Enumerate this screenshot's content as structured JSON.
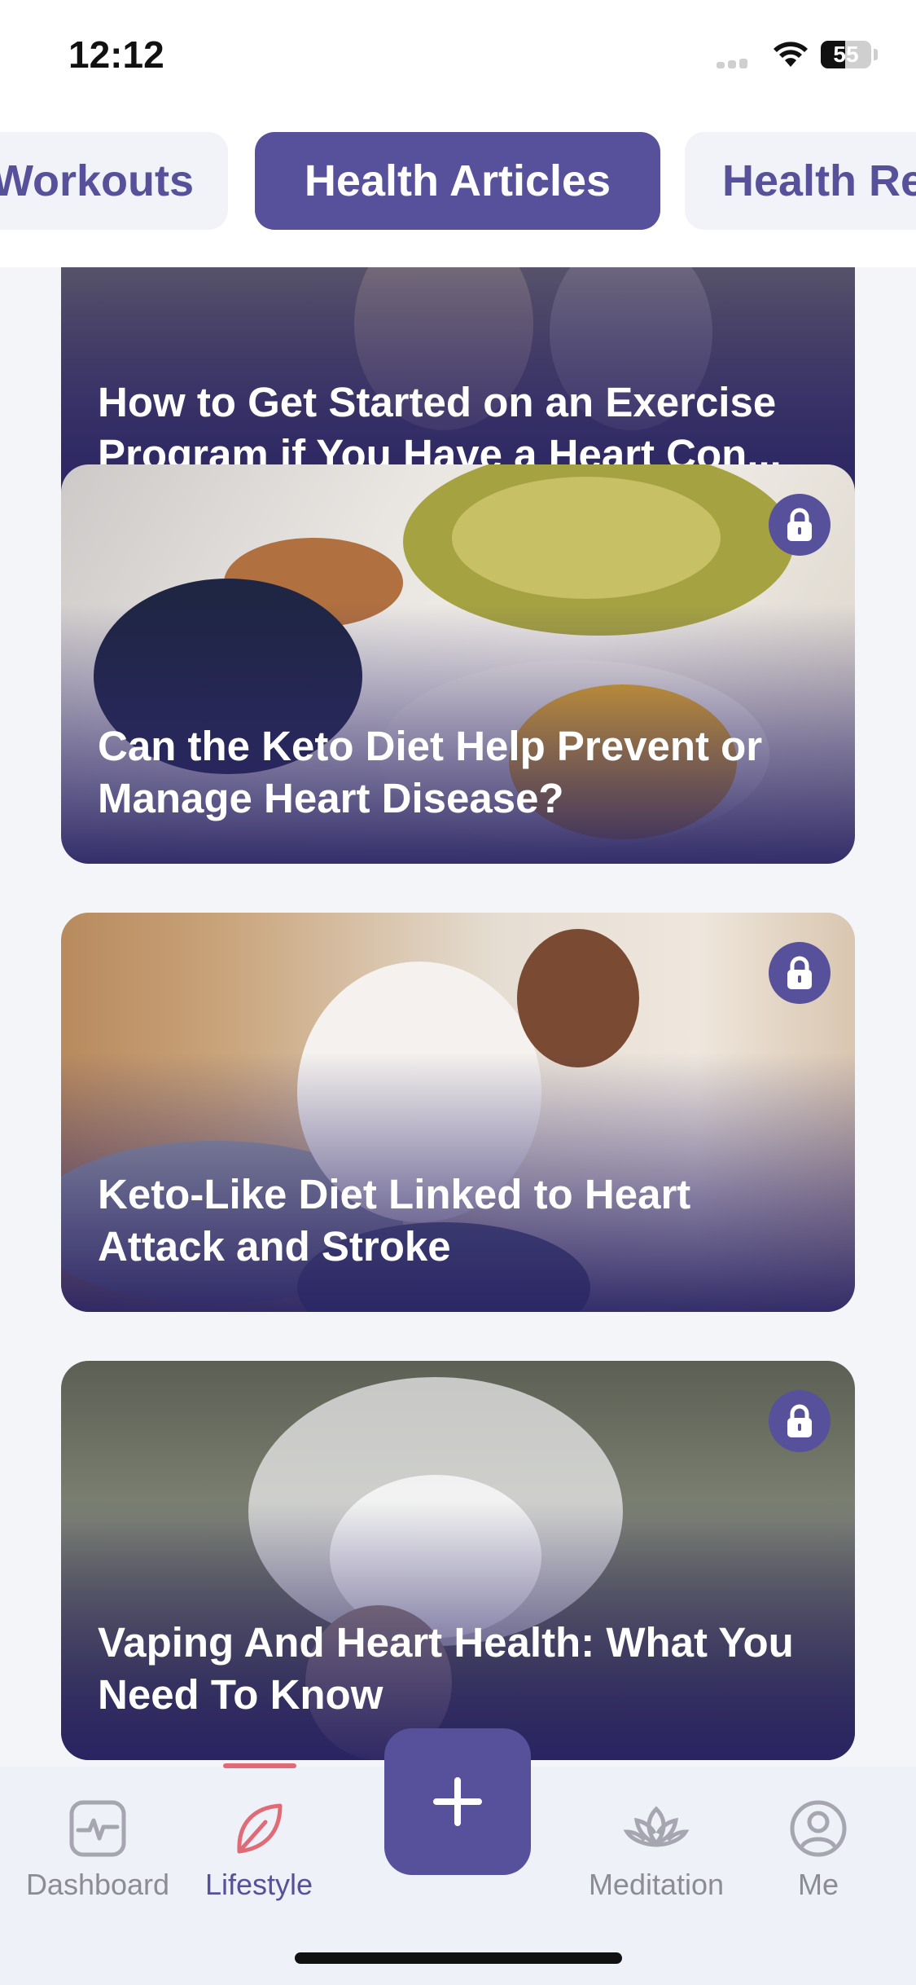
{
  "status_bar": {
    "time": "12:12",
    "battery": "55"
  },
  "tabs": [
    {
      "label": "Workouts",
      "active": false
    },
    {
      "label": "Health Articles",
      "active": true
    },
    {
      "label": "Health Re",
      "active": false
    }
  ],
  "articles": [
    {
      "title": "How to Get Started on an Exercise Program if You Have a Heart Con...",
      "locked": false
    },
    {
      "title": "Can the Keto Diet Help Prevent or Manage Heart Disease?",
      "locked": true
    },
    {
      "title": "Keto-Like Diet Linked to Heart Attack and Stroke",
      "locked": true
    },
    {
      "title": "Vaping And Heart Health: What You Need To Know",
      "locked": true
    }
  ],
  "bottom_nav": {
    "items": [
      {
        "label": "Dashboard",
        "icon": "pulse-icon"
      },
      {
        "label": "Lifestyle",
        "icon": "leaf-icon",
        "active": true
      },
      {
        "label": "Meditation",
        "icon": "lotus-icon"
      },
      {
        "label": "Me",
        "icon": "user-icon"
      }
    ],
    "fab_icon": "plus-icon"
  },
  "colors": {
    "accent": "#57509a",
    "active_indicator": "#e06b76",
    "background": "#f3f5f9"
  }
}
